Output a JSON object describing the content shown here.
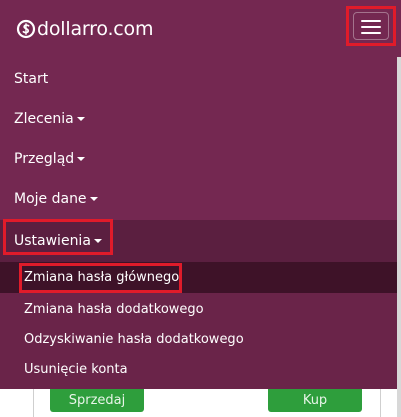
{
  "brand": {
    "text": "dollarro.com",
    "logo_icon": "dollar-circle-icon"
  },
  "toggler": {
    "icon": "hamburger-icon",
    "highlight_color": "#e01b2a"
  },
  "menu": {
    "items": [
      {
        "label": "Start",
        "has_caret": false
      },
      {
        "label": "Zlecenia",
        "has_caret": true
      },
      {
        "label": "Przegląd",
        "has_caret": true
      },
      {
        "label": "Moje dane",
        "has_caret": true
      },
      {
        "label": "Ustawienia",
        "has_caret": true,
        "active": true
      }
    ],
    "submenu": [
      {
        "label": "Zmiana hasła głównego",
        "active": true
      },
      {
        "label": "Zmiana hasła dodatkowego"
      },
      {
        "label": "Odzyskiwanie hasła dodatkowego"
      },
      {
        "label": "Usunięcie konta"
      }
    ]
  },
  "bottom": {
    "sell_label": "Sprzedaj",
    "buy_label": "Kup"
  },
  "colors": {
    "navbar": "#742851",
    "submenu": "#6a2449",
    "highlight": "#e01b2a",
    "button": "#2e9e3c"
  }
}
